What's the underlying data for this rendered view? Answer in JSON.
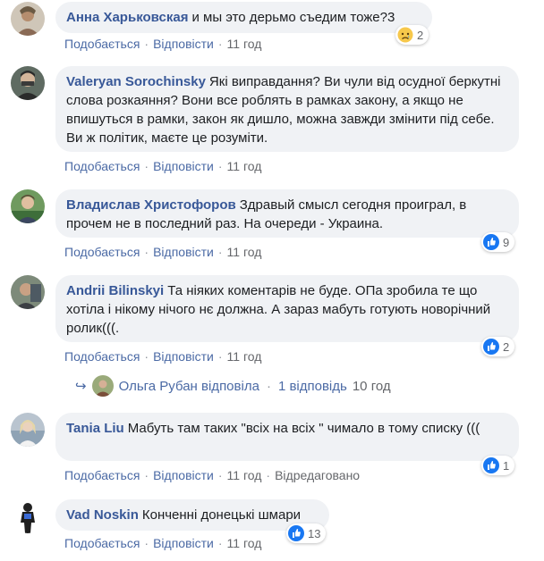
{
  "comments": [
    {
      "author": "Анна Харьковская",
      "text": "и мы это дерьмо съедим тоже?3",
      "like": "Подобається",
      "reply": "Відповісти",
      "time": "11 год",
      "reaction": {
        "type": "sad",
        "count": "2"
      }
    },
    {
      "author": "Valeryan Sorochinsky",
      "text": "Які виправдання? Ви чули від осудної беркутні слова розкаяння? Вони все роблять в рамках закону, а якщо не впишуться в рамки, закон як дишло, можна завжди змінити під себе. Ви ж політик, маєте це розуміти.",
      "like": "Подобається",
      "reply": "Відповісти",
      "time": "11 год"
    },
    {
      "author": "Владислав Христофоров",
      "text": "Здравый смысл сегодня проиграл, в прочем не в последний раз. На очереди - Украина.",
      "like": "Подобається",
      "reply": "Відповісти",
      "time": "11 год",
      "reaction": {
        "type": "like",
        "count": "9"
      }
    },
    {
      "author": "Andrii Bilinskyi",
      "text": "Та ніяких коментарів не буде. ОПа зробила те що хотіла і нікому нічого нє должна. А зараз мабуть готують новорічний ролик(((.",
      "like": "Подобається",
      "reply": "Відповісти",
      "time": "11 год",
      "reaction": {
        "type": "like",
        "count": "2"
      },
      "replies": {
        "name": "Ольга Рубан відповіла",
        "count": "1 відповідь",
        "time": "10 год"
      }
    },
    {
      "author": "Tania Liu",
      "text": "Мабуть там таких \"всіх на всіх \" чимало в тому списку (((",
      "like": "Подобається",
      "reply": "Відповісти",
      "time": "11 год",
      "edited": "Відредаговано",
      "reaction": {
        "type": "like",
        "count": "1"
      }
    },
    {
      "author": "Vad Noskin",
      "text": "Конченні донецькі шмари",
      "like": "Подобається",
      "reply": "Відповісти",
      "time": "11 год",
      "reaction": {
        "type": "like",
        "count": "13"
      }
    }
  ],
  "colors": {
    "author": "#385898",
    "bubble": "#f0f2f5",
    "action_link": "#4b6aa5",
    "like_blue": "#1877f2",
    "sad_yellow": "#f7c84b"
  }
}
